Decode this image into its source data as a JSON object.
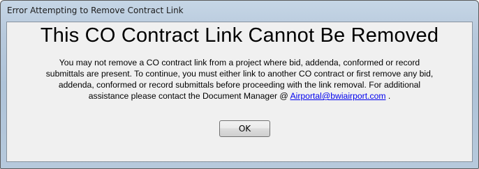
{
  "window": {
    "title": "Error Attempting to Remove Contract Link"
  },
  "dialog": {
    "heading": "This CO Contract Link Cannot Be Removed",
    "message_lines": [
      "You may not remove a CO contract link from a project where bid, addenda, conformed or record",
      "submittals are present.  To continue, you must either link to another CO contract or first remove any bid,",
      "addenda, conformed or record submittals before proceeding with the link removal.  For additional",
      "assistance please contact the Document Manager @ "
    ],
    "email": "Airportal@bwiairport.com",
    "message_end": " .",
    "ok_label": "OK"
  },
  "colors": {
    "frame": "#b7c9dc",
    "client_bg": "#f0f0f0",
    "link": "#0000ee"
  }
}
